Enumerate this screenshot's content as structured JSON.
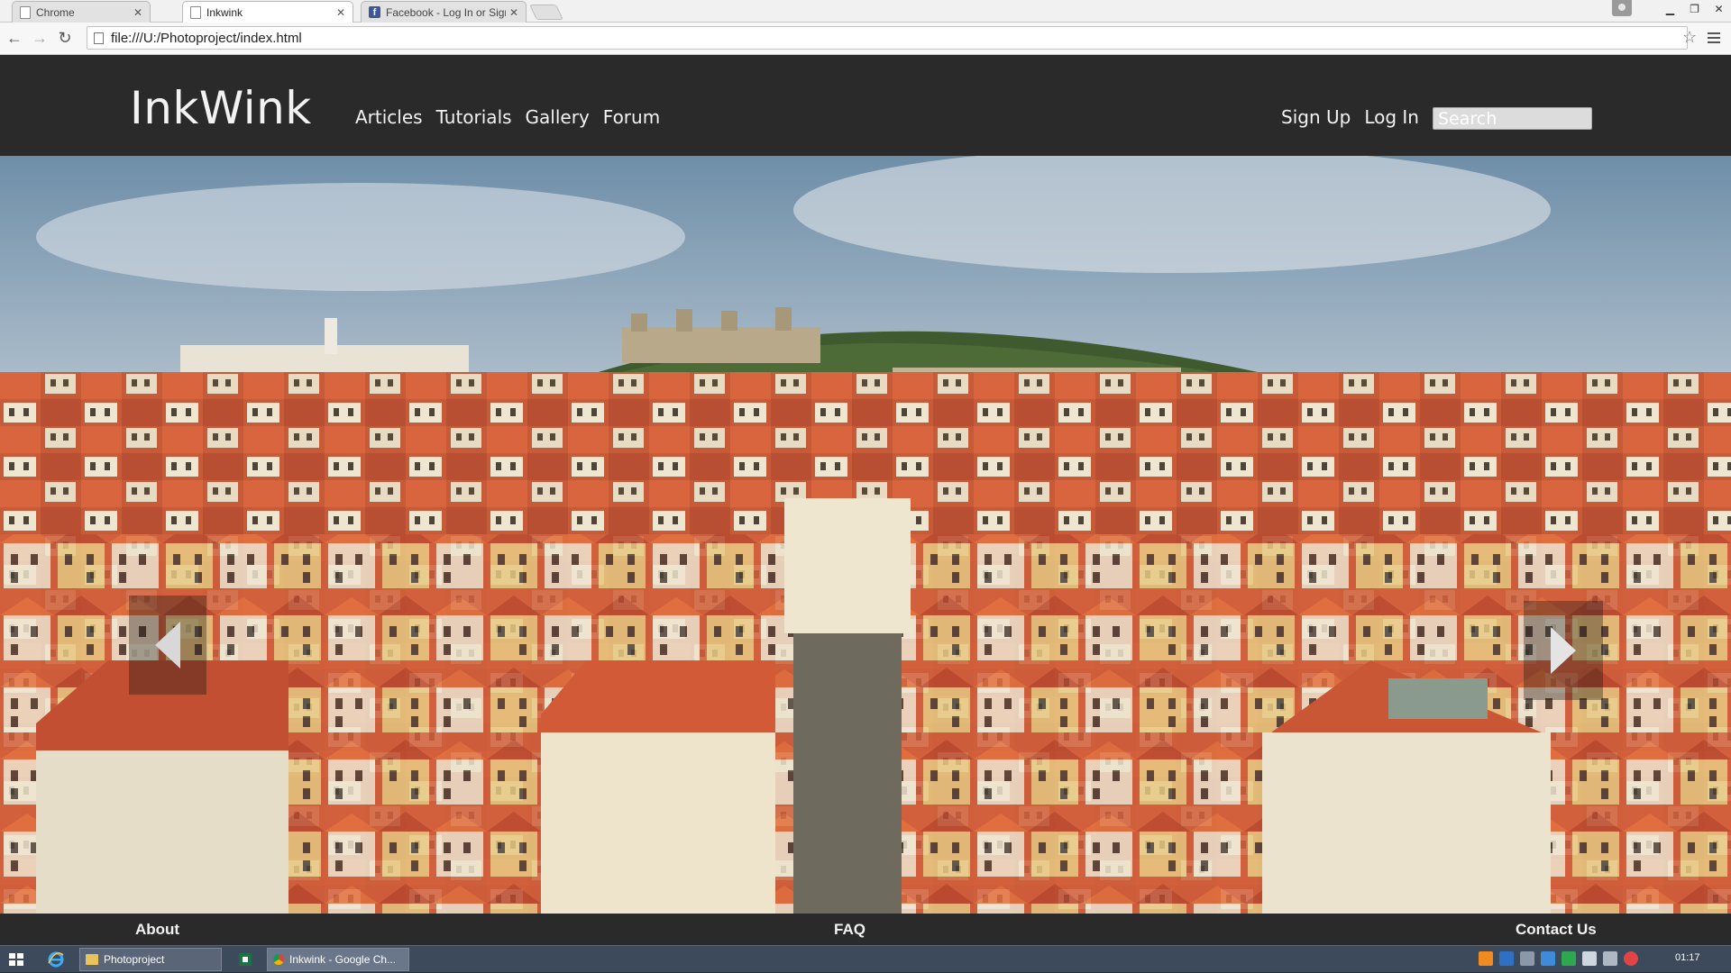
{
  "browser": {
    "tabs": [
      {
        "label": "Chrome",
        "active": false,
        "icon": "page-icon"
      },
      {
        "label": "Inkwink",
        "active": true,
        "icon": "page-icon"
      },
      {
        "label": "Facebook - Log In or Sign",
        "active": false,
        "icon": "facebook-icon"
      }
    ],
    "address": "file:///U:/Photoproject/index.html"
  },
  "site": {
    "logo": "InkWink",
    "nav": [
      "Articles",
      "Tutorials",
      "Gallery",
      "Forum"
    ],
    "auth": {
      "signup": "Sign Up",
      "login": "Log In"
    },
    "search_placeholder": "Search",
    "footer": {
      "about": "About",
      "faq": "FAQ",
      "contact": "Contact Us"
    }
  },
  "taskbar": {
    "tasks": [
      {
        "label": "Photoproject",
        "icon": "folder-icon"
      },
      {
        "label": "Inkwink - Google Ch...",
        "icon": "chrome-icon"
      }
    ],
    "clock": "01:17"
  },
  "colors": {
    "header_bg": "#2a2a2a",
    "header_text": "#f2f2f2",
    "taskbar_bg": "#3d4a5b"
  }
}
